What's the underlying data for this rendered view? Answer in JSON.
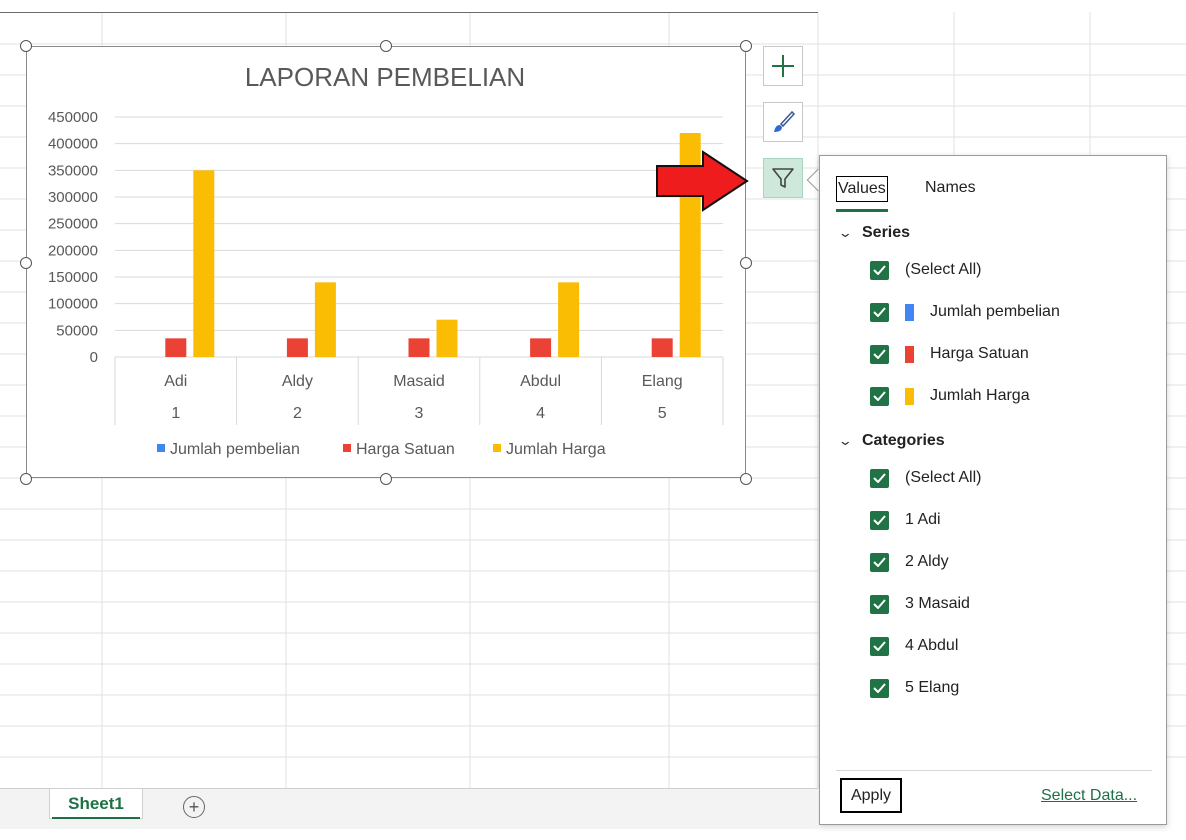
{
  "chart_data": {
    "type": "bar",
    "title": "LAPORAN PEMBELIAN",
    "categories": [
      "Adi",
      "Aldy",
      "Masaid",
      "Abdul",
      "Elang"
    ],
    "category_numbers": [
      "1",
      "2",
      "3",
      "4",
      "5"
    ],
    "ylim": [
      0,
      450000
    ],
    "y_ticks": [
      "450000",
      "400000",
      "350000",
      "300000",
      "250000",
      "200000",
      "150000",
      "100000",
      "50000",
      "0"
    ],
    "series": [
      {
        "name": "Jumlah pembelian",
        "color": "#4285f4",
        "values": [
          5,
          5,
          2,
          4,
          12
        ]
      },
      {
        "name": "Harga Satuan",
        "color": "#ea4335",
        "values": [
          35000,
          35000,
          35000,
          35000,
          35000
        ]
      },
      {
        "name": "Jumlah Harga",
        "color": "#fbbc04",
        "values": [
          350000,
          140000,
          70000,
          140000,
          420000
        ]
      }
    ],
    "legend_position": "bottom",
    "grid": true
  },
  "chart_buttons": {
    "elements": "plus-icon",
    "styles": "brush-icon",
    "filters": "funnel-icon"
  },
  "filter_panel": {
    "tabs": {
      "values": "Values",
      "names": "Names"
    },
    "series_heading": "Series",
    "categories_heading": "Categories",
    "select_all": "(Select All)",
    "series_items": [
      {
        "label": "Jumlah pembelian",
        "color": "#4285f4"
      },
      {
        "label": "Harga Satuan",
        "color": "#ea4335"
      },
      {
        "label": "Jumlah Harga",
        "color": "#fbbc04"
      }
    ],
    "category_items": [
      "1 Adi",
      "2 Aldy",
      "3 Masaid",
      "4 Abdul",
      "5 Elang"
    ],
    "apply": "Apply",
    "select_data": "Select Data..."
  },
  "sheet_tabs": {
    "active": "Sheet1",
    "add": "+"
  }
}
